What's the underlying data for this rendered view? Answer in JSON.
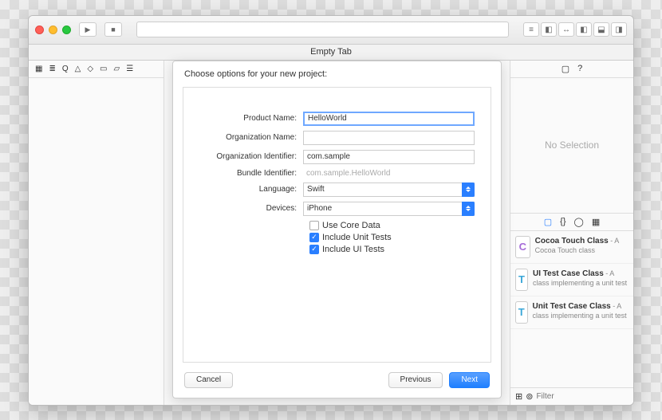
{
  "tab_title": "Empty Tab",
  "sheet": {
    "heading": "Choose options for your new project:",
    "labels": {
      "product": "Product Name:",
      "org_name": "Organization Name:",
      "org_id": "Organization Identifier:",
      "bundle": "Bundle Identifier:",
      "language": "Language:",
      "devices": "Devices:"
    },
    "values": {
      "product": "HelloWorld",
      "org_name": "",
      "org_id": "com.sample",
      "bundle": "com.sample.HelloWorld",
      "language": "Swift",
      "devices": "iPhone"
    },
    "checks": {
      "core_data": "Use Core Data",
      "unit": "Include Unit Tests",
      "ui": "Include UI Tests"
    },
    "buttons": {
      "cancel": "Cancel",
      "previous": "Previous",
      "next": "Next"
    }
  },
  "inspector": {
    "no_selection": "No Selection",
    "filter_placeholder": "Filter",
    "items": [
      {
        "glyph": "C",
        "cls": "c",
        "title": "Cocoa Touch Class",
        "sub": " - A Cocoa Touch class"
      },
      {
        "glyph": "T",
        "cls": "t",
        "title": "UI Test Case Class",
        "sub": " - A class implementing a unit test"
      },
      {
        "glyph": "T",
        "cls": "t",
        "title": "Unit Test Case Class",
        "sub": " - A class implementing a unit test"
      }
    ]
  }
}
